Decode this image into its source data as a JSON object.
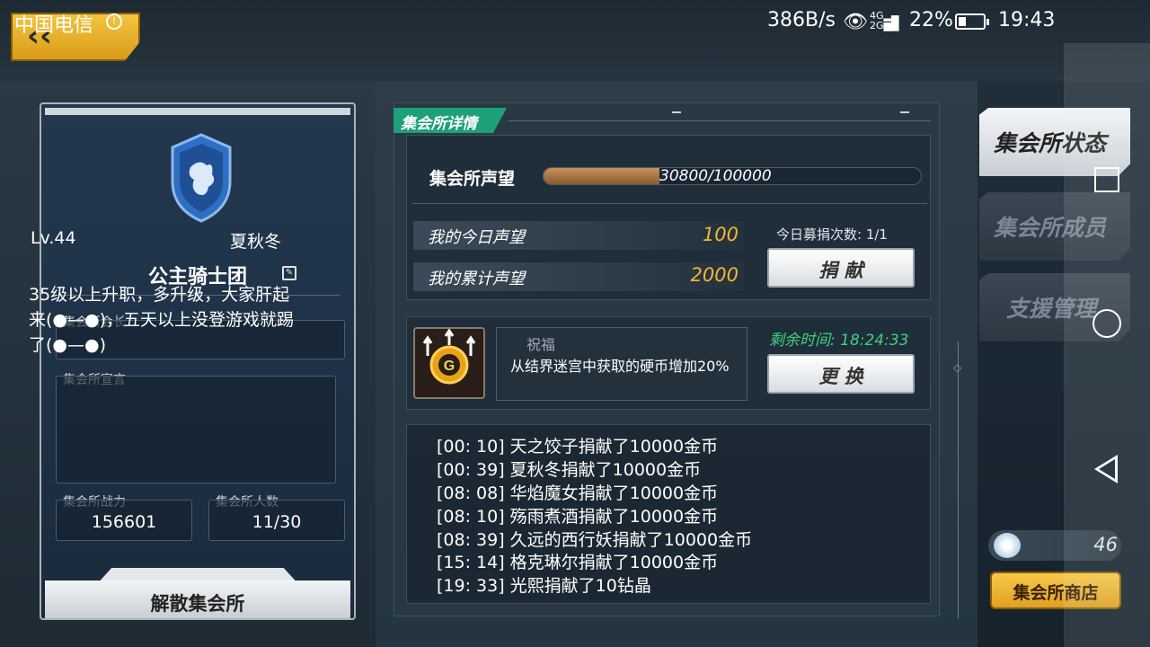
{
  "status_bar": {
    "carrier": "中国电信",
    "net_speed": "386B/s",
    "signal_text": "4G\n2G",
    "battery": "22%",
    "time": "19:43"
  },
  "guild": {
    "name": "公主骑士团",
    "leader_label": "集会所会长",
    "leader_level": "Lv.44",
    "leader_name": "夏秋冬",
    "declaration_label": "集会所宣言",
    "declaration": "35级以上升职，多升级，大家肝起来(●—●)，五天以上没登游戏就踢了(●—●)",
    "power_label": "集会所战力",
    "power": "156601",
    "members_label": "集会所人数",
    "members": "11/30",
    "disband_label": "解散集会所"
  },
  "detail": {
    "tab_label": "集会所详情",
    "reputation_label": "集会所声望",
    "reputation_text": "30800/100000",
    "reputation_progress": 0.308,
    "today_label": "我的今日声望",
    "today_value": "100",
    "total_label": "我的累计声望",
    "total_value": "2000",
    "donate_count": "今日募捐次数: 1/1",
    "donate_label": "捐 献",
    "bless_title": "祝福",
    "bless_desc": "从结界迷宫中获取的硬币增加20%",
    "remain_time": "剩余时间: 18:24:33",
    "change_label": "更 换"
  },
  "log": [
    "[00: 10] 天之饺子捐献了10000金币",
    "[00: 39] 夏秋冬捐献了10000金币",
    "[08: 08] 华焰魔女捐献了10000金币",
    "[08: 10] 殇雨煮酒捐献了10000金币",
    "[08: 39] 久远的西行妖捐献了10000金币",
    "[15: 14] 格克琳尔捐献了10000金币",
    "[19: 33] 光熙捐献了10钻晶"
  ],
  "side_tabs": [
    {
      "label": "集会所状态",
      "active": true
    },
    {
      "label": "集会所成员",
      "active": false
    },
    {
      "label": "支援管理",
      "active": false
    }
  ],
  "currency": {
    "icon": "gem-icon",
    "value": "46"
  },
  "shop_label": "集会所商店",
  "colors": {
    "accent_green": "#1ea07a",
    "gold": "#f2b630",
    "time_green": "#3ed27a",
    "shop_yellow": "#f7c948"
  }
}
